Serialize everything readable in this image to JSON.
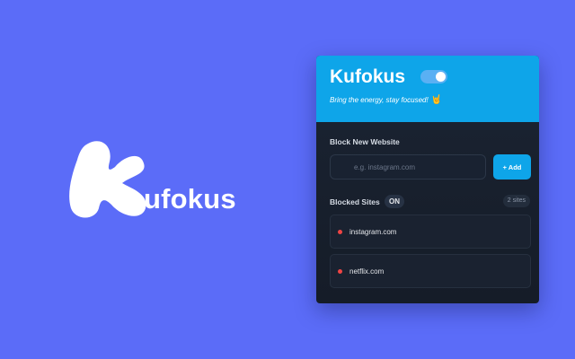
{
  "brand": {
    "logo_letter": "K",
    "logo_suffix": "ufokus",
    "logo_color": "#ffffff"
  },
  "background_color": "#5b6cf8",
  "popup": {
    "title": "Kufokus",
    "enabled": true,
    "tagline": "Bring the energy, stay focused!",
    "tagline_emoji": "🤘",
    "header_color": "#0ea5e9",
    "block_section": {
      "label": "Block New Website",
      "input_placeholder": "e.g. instagram.com",
      "input_value": "",
      "add_button_label": "+ Add"
    },
    "blocked_section": {
      "label": "Blocked Sites",
      "status_badge": "ON",
      "count_badge": "2 sites",
      "status_dot_color": "#ef4444",
      "sites": [
        {
          "name": "instagram.com"
        },
        {
          "name": "netflix.com"
        }
      ]
    }
  }
}
